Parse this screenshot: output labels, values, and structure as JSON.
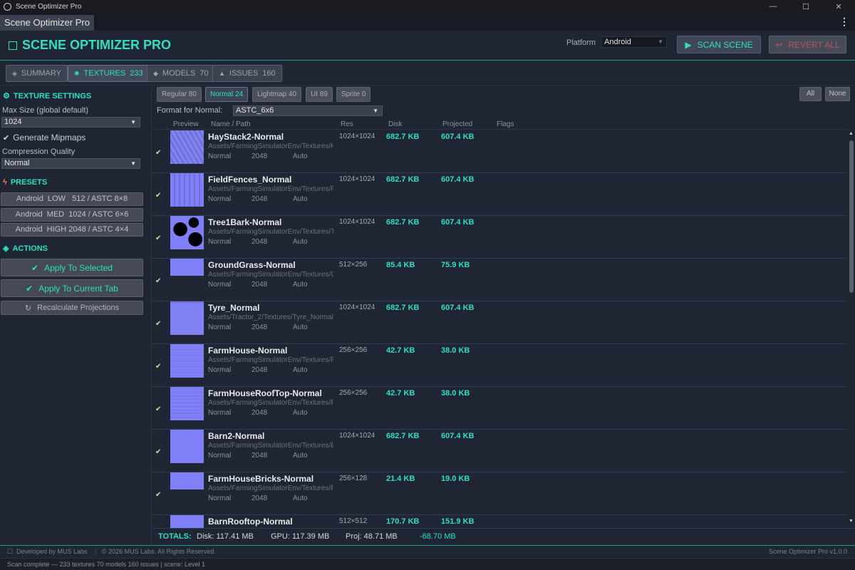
{
  "os_title": "Scene Optimizer Pro",
  "window_tab": "Scene Optimizer Pro",
  "app_title": "SCENE OPTIMIZER PRO",
  "platform": {
    "label": "Platform",
    "value": "Android"
  },
  "buttons": {
    "scan": "SCAN SCENE",
    "revert": "REVERT ALL"
  },
  "main_tabs": [
    {
      "label": "SUMMARY",
      "count": "",
      "icon": "diamond-icon"
    },
    {
      "label": "TEXTURES",
      "count": "233",
      "icon": "gear-icon"
    },
    {
      "label": "MODELS",
      "count": "70",
      "icon": "diamond-icon"
    },
    {
      "label": "ISSUES",
      "count": "160",
      "icon": "warning-icon"
    }
  ],
  "sidebar": {
    "texture_settings_title": "TEXTURE SETTINGS",
    "max_size_label": "Max Size  (global default)",
    "max_size_value": "1024",
    "mipmaps_label": "Generate Mipmaps",
    "compression_label": "Compression Quality",
    "compression_value": "Normal",
    "presets_title": "PRESETS",
    "presets": [
      "Android  LOW   512 / ASTC 8×8",
      "Android  MED  1024 / ASTC 6×6",
      "Android  HIGH 2048 / ASTC 4×4"
    ],
    "actions_title": "ACTIONS",
    "apply_selected": "Apply To Selected",
    "apply_tab": "Apply To Current Tab",
    "recalc": "Recalculate Projections"
  },
  "subtabs": [
    {
      "label": "Regular 80"
    },
    {
      "label": "Normal 24"
    },
    {
      "label": "Lightmap 40"
    },
    {
      "label": "UI 89"
    },
    {
      "label": "Sprite 0"
    }
  ],
  "select_all": "All",
  "select_none": "None",
  "format_label": "Format for Normal:",
  "format_value": "ASTC_6x6",
  "columns": {
    "preview": "Preview",
    "name": "Name / Path",
    "res": "Res",
    "disk": "Disk",
    "projected": "Projected",
    "flags": "Flags"
  },
  "rows": [
    {
      "name": "HayStack2-Normal",
      "path": "Assets/FarmingSimulatorEnv/Textures/H",
      "type": "Normal",
      "max": "2048",
      "comp": "Auto",
      "res": "1024×1024",
      "disk": "682.7 KB",
      "proj": "607.4 KB"
    },
    {
      "name": "FieldFences_Normal",
      "path": "Assets/FarmingSimulatorEnv/Textures/F",
      "type": "Normal",
      "max": "2048",
      "comp": "Auto",
      "res": "1024×1024",
      "disk": "682.7 KB",
      "proj": "607.4 KB"
    },
    {
      "name": "Tree1Bark-Normal",
      "path": "Assets/FarmingSimulatorEnv/Textures/T",
      "type": "Normal",
      "max": "2048",
      "comp": "Auto",
      "res": "1024×1024",
      "disk": "682.7 KB",
      "proj": "607.4 KB"
    },
    {
      "name": "GroundGrass-Normal",
      "path": "Assets/FarmingSimulatorEnv/Textures/G",
      "type": "Normal",
      "max": "2048",
      "comp": "Auto",
      "res": "512×256",
      "disk": "85.4 KB",
      "proj": "75.9 KB"
    },
    {
      "name": "Tyre_Normal",
      "path": "Assets/Tractor_2/Textures/Tyre_Normal.",
      "type": "Normal",
      "max": "2048",
      "comp": "Auto",
      "res": "1024×1024",
      "disk": "682.7 KB",
      "proj": "607.4 KB"
    },
    {
      "name": "FarmHouse-Normal",
      "path": "Assets/FarmingSimulatorEnv/Textures/F",
      "type": "Normal",
      "max": "2048",
      "comp": "Auto",
      "res": "256×256",
      "disk": "42.7 KB",
      "proj": "38.0 KB"
    },
    {
      "name": "FarmHouseRoofTop-Normal",
      "path": "Assets/FarmingSimulatorEnv/Textures/F",
      "type": "Normal",
      "max": "2048",
      "comp": "Auto",
      "res": "256×256",
      "disk": "42.7 KB",
      "proj": "38.0 KB"
    },
    {
      "name": "Barn2-Normal",
      "path": "Assets/FarmingSimulatorEnv/Textures/B",
      "type": "Normal",
      "max": "2048",
      "comp": "Auto",
      "res": "1024×1024",
      "disk": "682.7 KB",
      "proj": "607.4 KB"
    },
    {
      "name": "FarmHouseBricks-Normal",
      "path": "Assets/FarmingSimulatorEnv/Textures/F",
      "type": "Normal",
      "max": "2048",
      "comp": "Auto",
      "res": "256×128",
      "disk": "21.4 KB",
      "proj": "19.0 KB"
    },
    {
      "name": "BarnRooftop-Normal",
      "path": "",
      "type": "",
      "max": "",
      "comp": "",
      "res": "512×512",
      "disk": "170.7 KB",
      "proj": "151.9 KB"
    }
  ],
  "totals": {
    "label": "TOTALS:",
    "disk": "Disk: 117.41 MB",
    "gpu": "GPU: 117.39 MB",
    "proj": "Proj: 48.71 MB",
    "delta": "-68.70 MB"
  },
  "footer": {
    "developed": "Developed by  MUS Labs",
    "copyright": "© 2026 MUS Labs. All Rights Reserved.",
    "version": "Scene Optimizer Pro  v1.0.0"
  },
  "status": "Scan complete — 233 textures  70 models  160 issues  |  scene: Level 1",
  "colors": {
    "accent": "#2ee0bd",
    "revert": "#b25563",
    "background": "#1f2532"
  }
}
